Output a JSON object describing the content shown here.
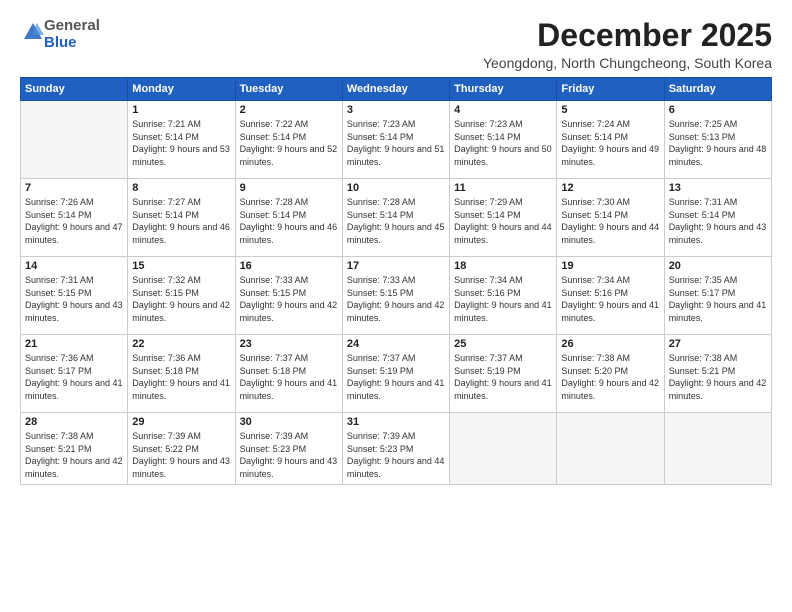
{
  "logo": {
    "general": "General",
    "blue": "Blue"
  },
  "title": "December 2025",
  "location": "Yeongdong, North Chungcheong, South Korea",
  "headers": [
    "Sunday",
    "Monday",
    "Tuesday",
    "Wednesday",
    "Thursday",
    "Friday",
    "Saturday"
  ],
  "weeks": [
    [
      {
        "day": "",
        "sunrise": "",
        "sunset": "",
        "daylight": ""
      },
      {
        "day": "1",
        "sunrise": "Sunrise: 7:21 AM",
        "sunset": "Sunset: 5:14 PM",
        "daylight": "Daylight: 9 hours and 53 minutes."
      },
      {
        "day": "2",
        "sunrise": "Sunrise: 7:22 AM",
        "sunset": "Sunset: 5:14 PM",
        "daylight": "Daylight: 9 hours and 52 minutes."
      },
      {
        "day": "3",
        "sunrise": "Sunrise: 7:23 AM",
        "sunset": "Sunset: 5:14 PM",
        "daylight": "Daylight: 9 hours and 51 minutes."
      },
      {
        "day": "4",
        "sunrise": "Sunrise: 7:23 AM",
        "sunset": "Sunset: 5:14 PM",
        "daylight": "Daylight: 9 hours and 50 minutes."
      },
      {
        "day": "5",
        "sunrise": "Sunrise: 7:24 AM",
        "sunset": "Sunset: 5:14 PM",
        "daylight": "Daylight: 9 hours and 49 minutes."
      },
      {
        "day": "6",
        "sunrise": "Sunrise: 7:25 AM",
        "sunset": "Sunset: 5:13 PM",
        "daylight": "Daylight: 9 hours and 48 minutes."
      }
    ],
    [
      {
        "day": "7",
        "sunrise": "Sunrise: 7:26 AM",
        "sunset": "Sunset: 5:14 PM",
        "daylight": "Daylight: 9 hours and 47 minutes."
      },
      {
        "day": "8",
        "sunrise": "Sunrise: 7:27 AM",
        "sunset": "Sunset: 5:14 PM",
        "daylight": "Daylight: 9 hours and 46 minutes."
      },
      {
        "day": "9",
        "sunrise": "Sunrise: 7:28 AM",
        "sunset": "Sunset: 5:14 PM",
        "daylight": "Daylight: 9 hours and 46 minutes."
      },
      {
        "day": "10",
        "sunrise": "Sunrise: 7:28 AM",
        "sunset": "Sunset: 5:14 PM",
        "daylight": "Daylight: 9 hours and 45 minutes."
      },
      {
        "day": "11",
        "sunrise": "Sunrise: 7:29 AM",
        "sunset": "Sunset: 5:14 PM",
        "daylight": "Daylight: 9 hours and 44 minutes."
      },
      {
        "day": "12",
        "sunrise": "Sunrise: 7:30 AM",
        "sunset": "Sunset: 5:14 PM",
        "daylight": "Daylight: 9 hours and 44 minutes."
      },
      {
        "day": "13",
        "sunrise": "Sunrise: 7:31 AM",
        "sunset": "Sunset: 5:14 PM",
        "daylight": "Daylight: 9 hours and 43 minutes."
      }
    ],
    [
      {
        "day": "14",
        "sunrise": "Sunrise: 7:31 AM",
        "sunset": "Sunset: 5:15 PM",
        "daylight": "Daylight: 9 hours and 43 minutes."
      },
      {
        "day": "15",
        "sunrise": "Sunrise: 7:32 AM",
        "sunset": "Sunset: 5:15 PM",
        "daylight": "Daylight: 9 hours and 42 minutes."
      },
      {
        "day": "16",
        "sunrise": "Sunrise: 7:33 AM",
        "sunset": "Sunset: 5:15 PM",
        "daylight": "Daylight: 9 hours and 42 minutes."
      },
      {
        "day": "17",
        "sunrise": "Sunrise: 7:33 AM",
        "sunset": "Sunset: 5:15 PM",
        "daylight": "Daylight: 9 hours and 42 minutes."
      },
      {
        "day": "18",
        "sunrise": "Sunrise: 7:34 AM",
        "sunset": "Sunset: 5:16 PM",
        "daylight": "Daylight: 9 hours and 41 minutes."
      },
      {
        "day": "19",
        "sunrise": "Sunrise: 7:34 AM",
        "sunset": "Sunset: 5:16 PM",
        "daylight": "Daylight: 9 hours and 41 minutes."
      },
      {
        "day": "20",
        "sunrise": "Sunrise: 7:35 AM",
        "sunset": "Sunset: 5:17 PM",
        "daylight": "Daylight: 9 hours and 41 minutes."
      }
    ],
    [
      {
        "day": "21",
        "sunrise": "Sunrise: 7:36 AM",
        "sunset": "Sunset: 5:17 PM",
        "daylight": "Daylight: 9 hours and 41 minutes."
      },
      {
        "day": "22",
        "sunrise": "Sunrise: 7:36 AM",
        "sunset": "Sunset: 5:18 PM",
        "daylight": "Daylight: 9 hours and 41 minutes."
      },
      {
        "day": "23",
        "sunrise": "Sunrise: 7:37 AM",
        "sunset": "Sunset: 5:18 PM",
        "daylight": "Daylight: 9 hours and 41 minutes."
      },
      {
        "day": "24",
        "sunrise": "Sunrise: 7:37 AM",
        "sunset": "Sunset: 5:19 PM",
        "daylight": "Daylight: 9 hours and 41 minutes."
      },
      {
        "day": "25",
        "sunrise": "Sunrise: 7:37 AM",
        "sunset": "Sunset: 5:19 PM",
        "daylight": "Daylight: 9 hours and 41 minutes."
      },
      {
        "day": "26",
        "sunrise": "Sunrise: 7:38 AM",
        "sunset": "Sunset: 5:20 PM",
        "daylight": "Daylight: 9 hours and 42 minutes."
      },
      {
        "day": "27",
        "sunrise": "Sunrise: 7:38 AM",
        "sunset": "Sunset: 5:21 PM",
        "daylight": "Daylight: 9 hours and 42 minutes."
      }
    ],
    [
      {
        "day": "28",
        "sunrise": "Sunrise: 7:38 AM",
        "sunset": "Sunset: 5:21 PM",
        "daylight": "Daylight: 9 hours and 42 minutes."
      },
      {
        "day": "29",
        "sunrise": "Sunrise: 7:39 AM",
        "sunset": "Sunset: 5:22 PM",
        "daylight": "Daylight: 9 hours and 43 minutes."
      },
      {
        "day": "30",
        "sunrise": "Sunrise: 7:39 AM",
        "sunset": "Sunset: 5:23 PM",
        "daylight": "Daylight: 9 hours and 43 minutes."
      },
      {
        "day": "31",
        "sunrise": "Sunrise: 7:39 AM",
        "sunset": "Sunset: 5:23 PM",
        "daylight": "Daylight: 9 hours and 44 minutes."
      },
      {
        "day": "",
        "sunrise": "",
        "sunset": "",
        "daylight": ""
      },
      {
        "day": "",
        "sunrise": "",
        "sunset": "",
        "daylight": ""
      },
      {
        "day": "",
        "sunrise": "",
        "sunset": "",
        "daylight": ""
      }
    ]
  ]
}
